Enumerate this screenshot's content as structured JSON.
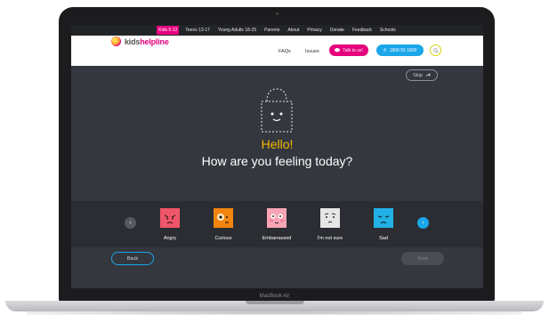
{
  "topnav": {
    "items": [
      "Kids 5-12",
      "Teens 13-17",
      "Young Adults 18-25",
      "Parents",
      "About",
      "Privacy",
      "Donate",
      "Feedback",
      "Schools"
    ]
  },
  "header": {
    "logo_kids": "kids",
    "logo_helpline": "helpline",
    "faqs": "FAQs",
    "issues": "Issues",
    "talk_label": "Talk to us!",
    "phone_label": "1800 55 1800"
  },
  "skip_label": "Skip",
  "greeting": "Hello!",
  "question": "How are you feeling today?",
  "moods": [
    {
      "label": "Angry",
      "color": "#f0566a"
    },
    {
      "label": "Curious",
      "color": "#f2850f"
    },
    {
      "label": "Embarrassed",
      "color": "#f7a4b4"
    },
    {
      "label": "I'm not sure",
      "color": "#e6e6e6"
    },
    {
      "label": "Sad",
      "color": "#22b1e6"
    }
  ],
  "back_label": "Back",
  "next_label": "Next",
  "device_label": "MacBook Air",
  "colors": {
    "accent_pink": "#e6007e",
    "accent_blue": "#1aa6e8",
    "greeting_yellow": "#f5b800"
  }
}
